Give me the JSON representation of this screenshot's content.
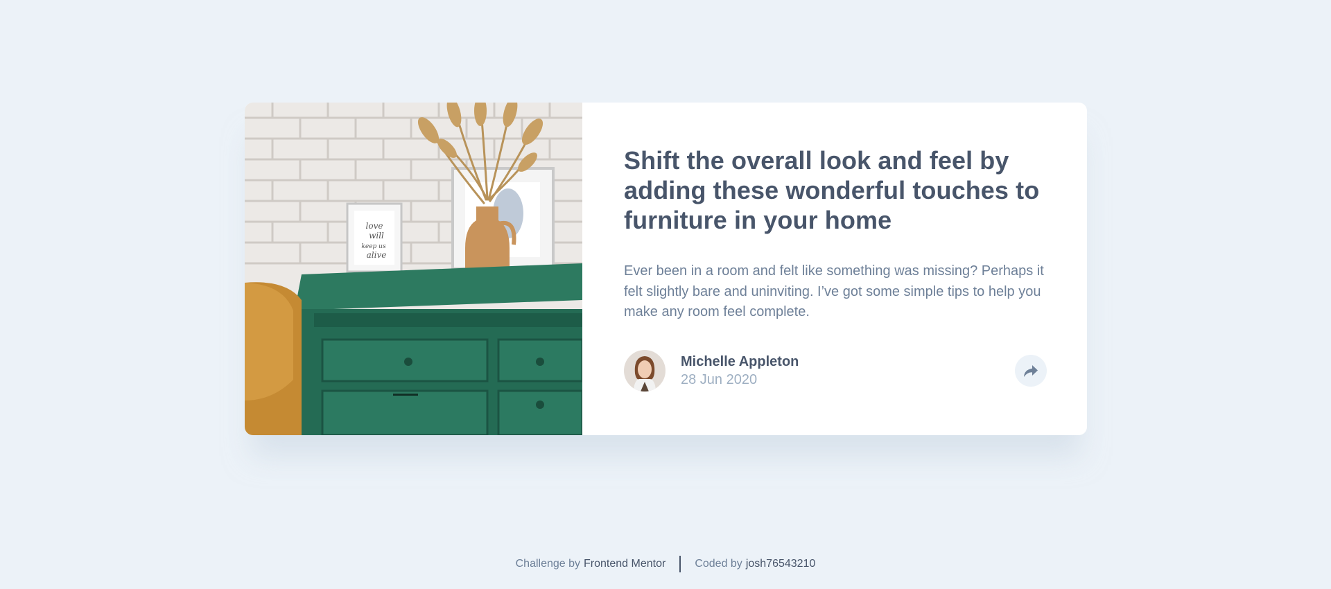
{
  "card": {
    "image": {
      "alt": "Green drawers with a vase of dried grass and framed pictures against a white brick wall",
      "frame_text": [
        "love",
        "will",
        "keep us",
        "alive"
      ]
    },
    "title": "Shift the overall look and feel by adding these wonderful touches to furniture in your home",
    "description": "Ever been in a room and felt like something was missing? Perhaps it felt slightly bare and uninviting. I’ve got some simple tips to help you make any room feel complete.",
    "author": {
      "name": "Michelle Appleton",
      "date": "28 Jun 2020"
    },
    "share_icon": "share-icon"
  },
  "attribution": {
    "challenge_prefix": "Challenge by",
    "challenge_link": "Frontend Mentor",
    "coded_prefix": "Coded by",
    "coded_link": "josh76543210"
  },
  "colors": {
    "background": "#ecf2f8",
    "card": "#ffffff",
    "title": "#48556a",
    "body_text": "#6e8098",
    "muted_text": "#9eafc2"
  }
}
